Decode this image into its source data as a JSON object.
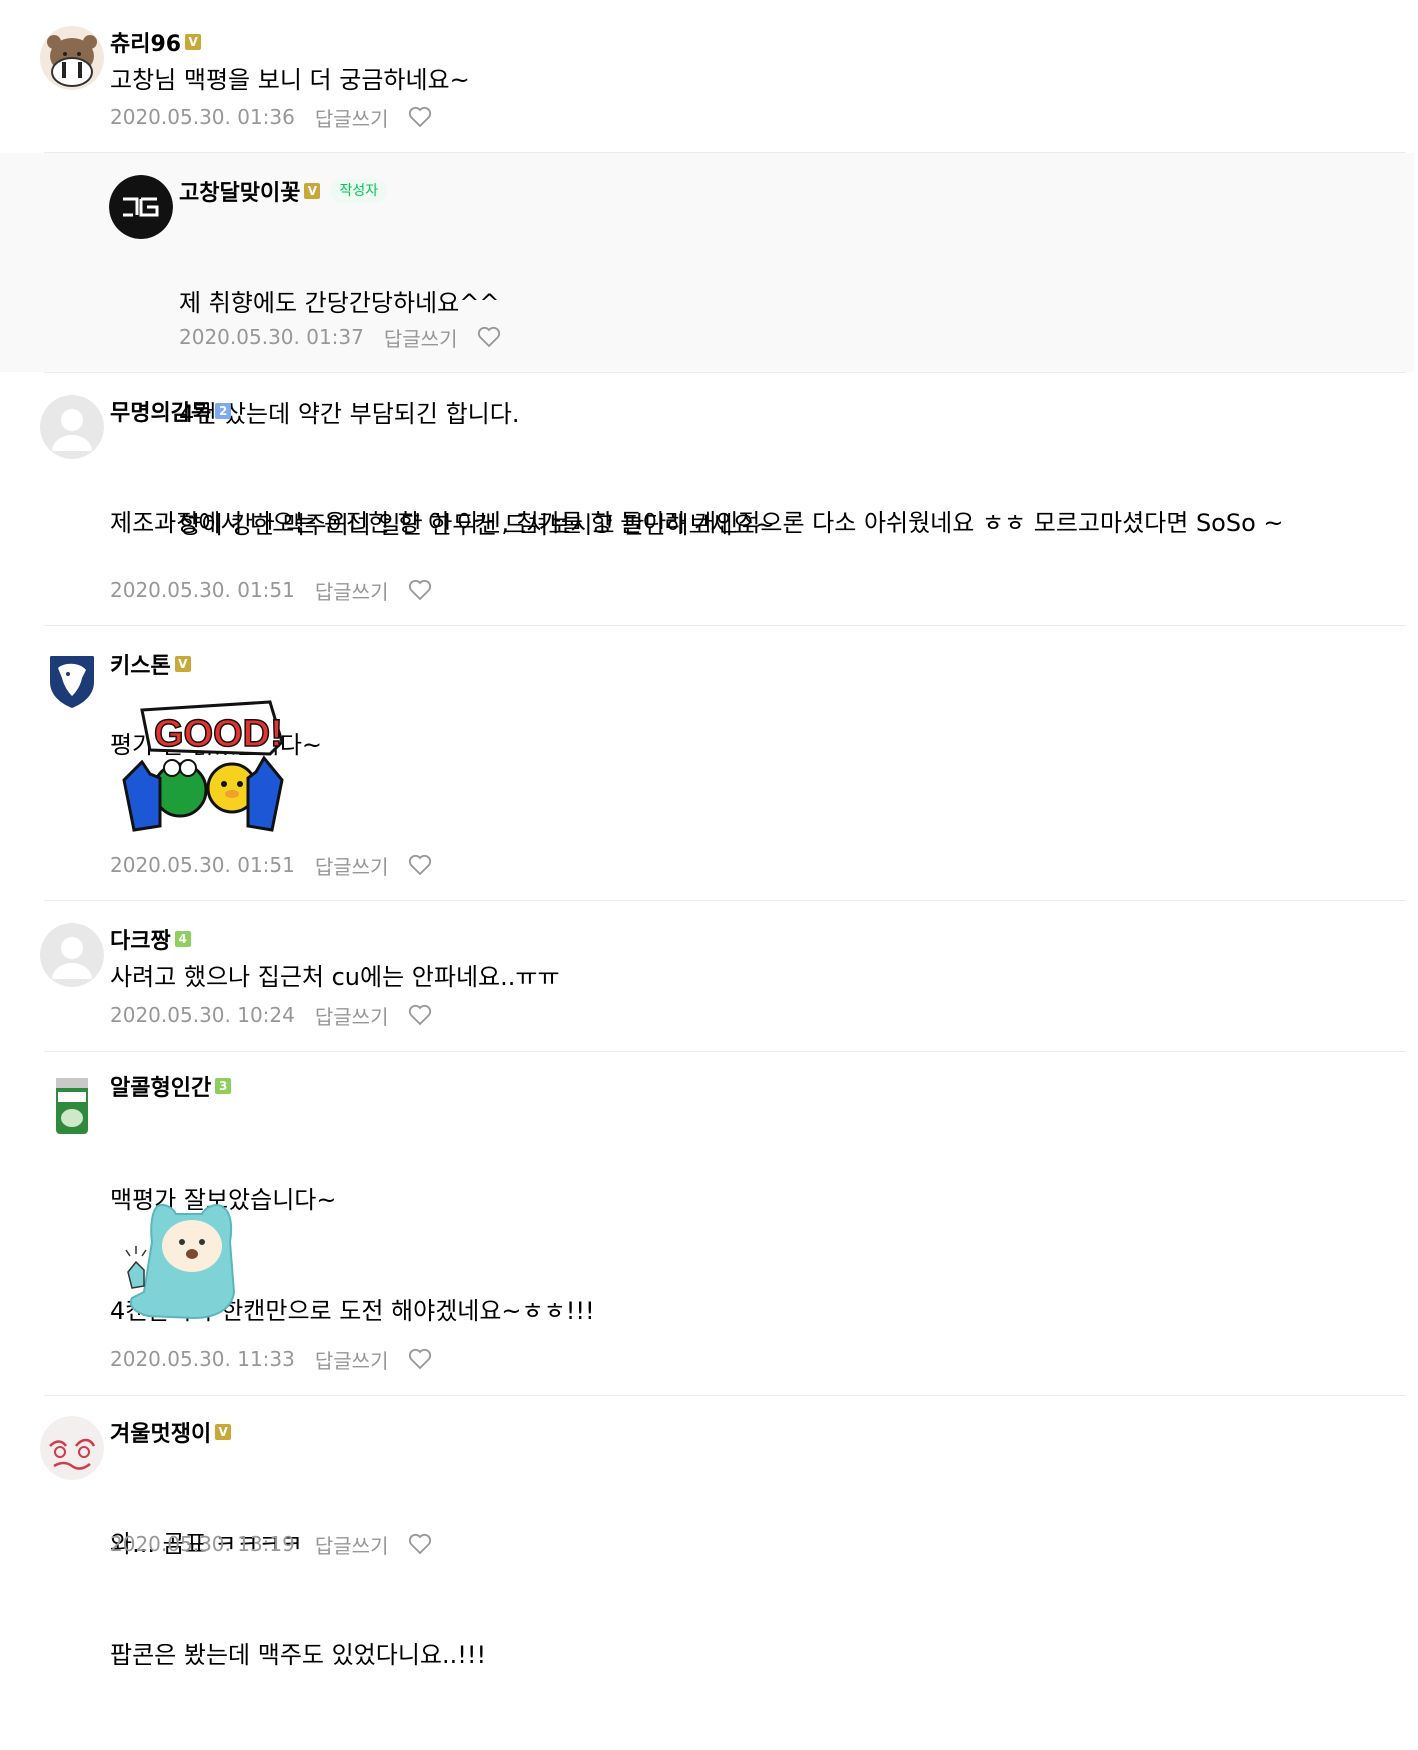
{
  "ui": {
    "reply_label": "답글쓰기",
    "author_tag": "작성자",
    "colors": {
      "badge_gold": "#c9a83a",
      "badge_blue": "#7eaaf3",
      "badge_green": "#8fcf5e",
      "author_tag_text": "#03c75a",
      "meta_gray": "#979797",
      "reply_bg": "#f9f9f9"
    }
  },
  "comments": [
    {
      "nickname": "츄리96",
      "badge": "V",
      "avatar_icon": "bear-avatar-icon",
      "lines": [
        "고창님 맥평을 보니 더 궁금하네요~"
      ],
      "date": "2020.05.30. 01:36"
    },
    {
      "nickname": "고창달맞이꽃",
      "badge": "V",
      "is_author": true,
      "avatar_icon": "gochang-logo-avatar-icon",
      "lines": [
        "제 취향에도 간당간당하네요^^",
        "4캔 샀는데 약간 부담되긴 합니다.",
        "향이 강한 맥주이니 일단 한두캔 드셔보시고 판단해보세요~"
      ],
      "date": "2020.05.30. 01:37"
    },
    {
      "nickname": "무명의감독",
      "badge": "2",
      "avatar_icon": "default-profile-icon",
      "lines": [
        "제조과정에서 나오는 온전한 향 이 아닌, 첨가물 향 들이라 개인적으론 다소 아쉬웠네요 ㅎㅎ 모르고마셨다면 SoSo ~",
        "",
        "평가 잘 읽었습니다~"
      ],
      "date": "2020.05.30. 01:51"
    },
    {
      "nickname": "키스톤",
      "badge": "V",
      "avatar_icon": "lion-shield-avatar-icon",
      "sticker": "good-thumbs-up-sticker",
      "sticker_text": "GOOD!",
      "date": "2020.05.30. 01:51"
    },
    {
      "nickname": "다크짱",
      "badge": "4",
      "avatar_icon": "default-profile-icon",
      "lines": [
        "사려고 했으나 집근처 cu에는 안파네요..ㅠㅠ"
      ],
      "date": "2020.05.30. 10:24"
    },
    {
      "nickname": "알콜형인간",
      "badge": "3",
      "avatar_icon": "beer-can-avatar-icon",
      "lines": [
        "맥평가 잘보았습니다~",
        "4캔살려다 한캔만으로 도전 해야겠네요~ㅎㅎ!!!"
      ],
      "sticker": "blue-bear-thumbs-up-sticker",
      "date": "2020.05.30. 11:33"
    },
    {
      "nickname": "겨울멋쟁이",
      "badge": "V",
      "avatar_icon": "doodle-face-avatar-icon",
      "lines": [
        "와... 곰표 ㅋㅋㅋㅋ",
        "팝콘은 봤는데 맥주도 있었다니요..!!!"
      ],
      "date": "2020.05.30. 13:19"
    }
  ]
}
